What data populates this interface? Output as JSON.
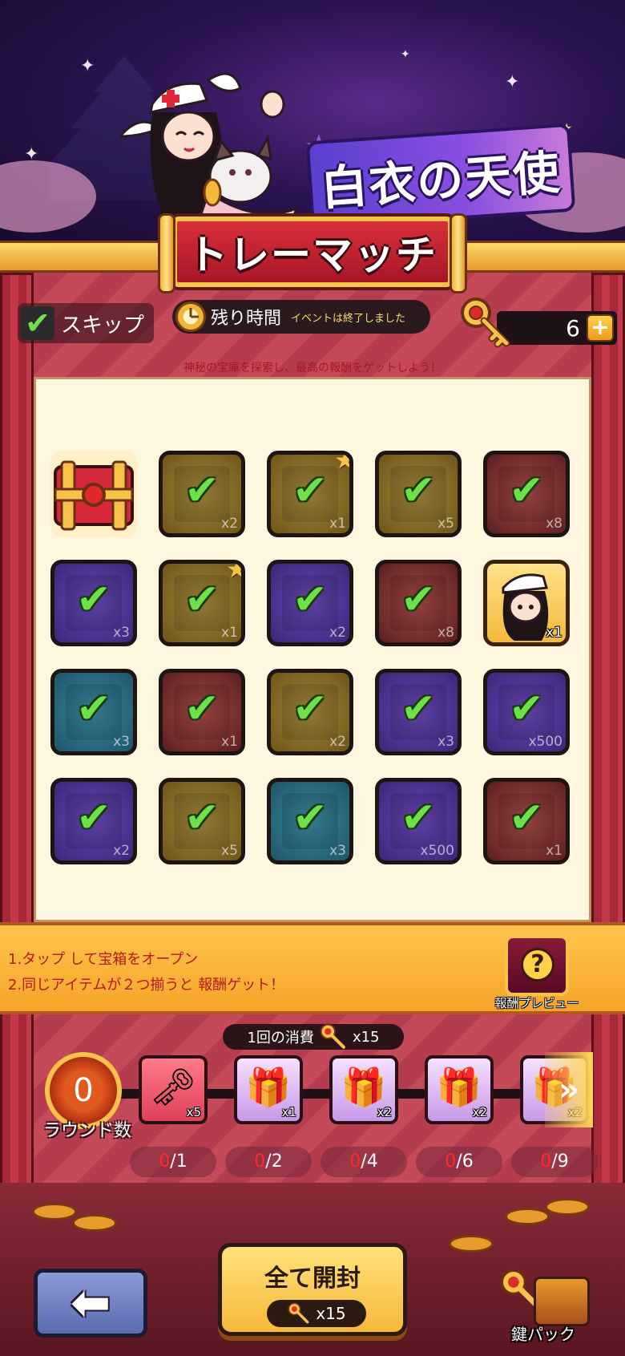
{
  "banner": {
    "event_title": "白衣の天使"
  },
  "header": {
    "title": "トレーマッチ"
  },
  "status": {
    "skip_label": "スキップ",
    "timer_label": "残り時間",
    "timer_status": "イベントは終了しました",
    "keys": "6",
    "plus": "+"
  },
  "subtitle": "神秘の宝庫を探索し、最高の報酬をゲットしよう！",
  "grid": {
    "rows": [
      [
        {
          "kind": "chest-closed",
          "qty": ""
        },
        {
          "kind": "gold",
          "qty": "x2"
        },
        {
          "kind": "gold",
          "qty": "x1",
          "star": true
        },
        {
          "kind": "gold",
          "qty": "x5"
        },
        {
          "kind": "red",
          "qty": "x8"
        }
      ],
      [
        {
          "kind": "purple",
          "qty": "x3"
        },
        {
          "kind": "gold",
          "qty": "x1",
          "star": true
        },
        {
          "kind": "purple",
          "qty": "x2"
        },
        {
          "kind": "red",
          "qty": "x8"
        },
        {
          "kind": "gold-lit",
          "qty": "x1",
          "highlight": true
        }
      ],
      [
        {
          "kind": "teal",
          "qty": "x3"
        },
        {
          "kind": "red",
          "qty": "x1"
        },
        {
          "kind": "gold",
          "qty": "x2"
        },
        {
          "kind": "purple",
          "qty": "x3"
        },
        {
          "kind": "purple",
          "qty": "x500"
        }
      ],
      [
        {
          "kind": "purple",
          "qty": "x2"
        },
        {
          "kind": "gold",
          "qty": "x5"
        },
        {
          "kind": "teal",
          "qty": "x3"
        },
        {
          "kind": "purple",
          "qty": "x500"
        },
        {
          "kind": "red",
          "qty": "x1"
        }
      ]
    ]
  },
  "instructions": {
    "line1": "1.タップ して宝箱をオープン",
    "line2": "2.同じアイテムが２つ揃うと 報酬ゲット！",
    "preview_label": "報酬プレビュー",
    "preview_icon": "?"
  },
  "round": {
    "cost_label": "1回の消費",
    "cost_qty": "x15",
    "count": "0",
    "count_label": "ラウンド数",
    "rewards": [
      {
        "type": "key-pink",
        "qty": "x5",
        "progress_cur": "0",
        "progress_max": "/1"
      },
      {
        "type": "gift",
        "qty": "x1",
        "progress_cur": "0",
        "progress_max": "/2"
      },
      {
        "type": "gift",
        "qty": "x2",
        "progress_cur": "0",
        "progress_max": "/4"
      },
      {
        "type": "gift",
        "qty": "x2",
        "progress_cur": "0",
        "progress_max": "/6"
      },
      {
        "type": "gift",
        "qty": "x2",
        "progress_cur": "0",
        "progress_max": "/9"
      }
    ]
  },
  "footer": {
    "open_all_label": "全て開封",
    "open_all_cost": "x15",
    "key_pack_label": "鍵パック"
  },
  "colors": {
    "check": "#6ee04a",
    "accent_gold": "#f6c24a",
    "accent_red": "#a81626",
    "progress_current": "#ff2a2a"
  }
}
